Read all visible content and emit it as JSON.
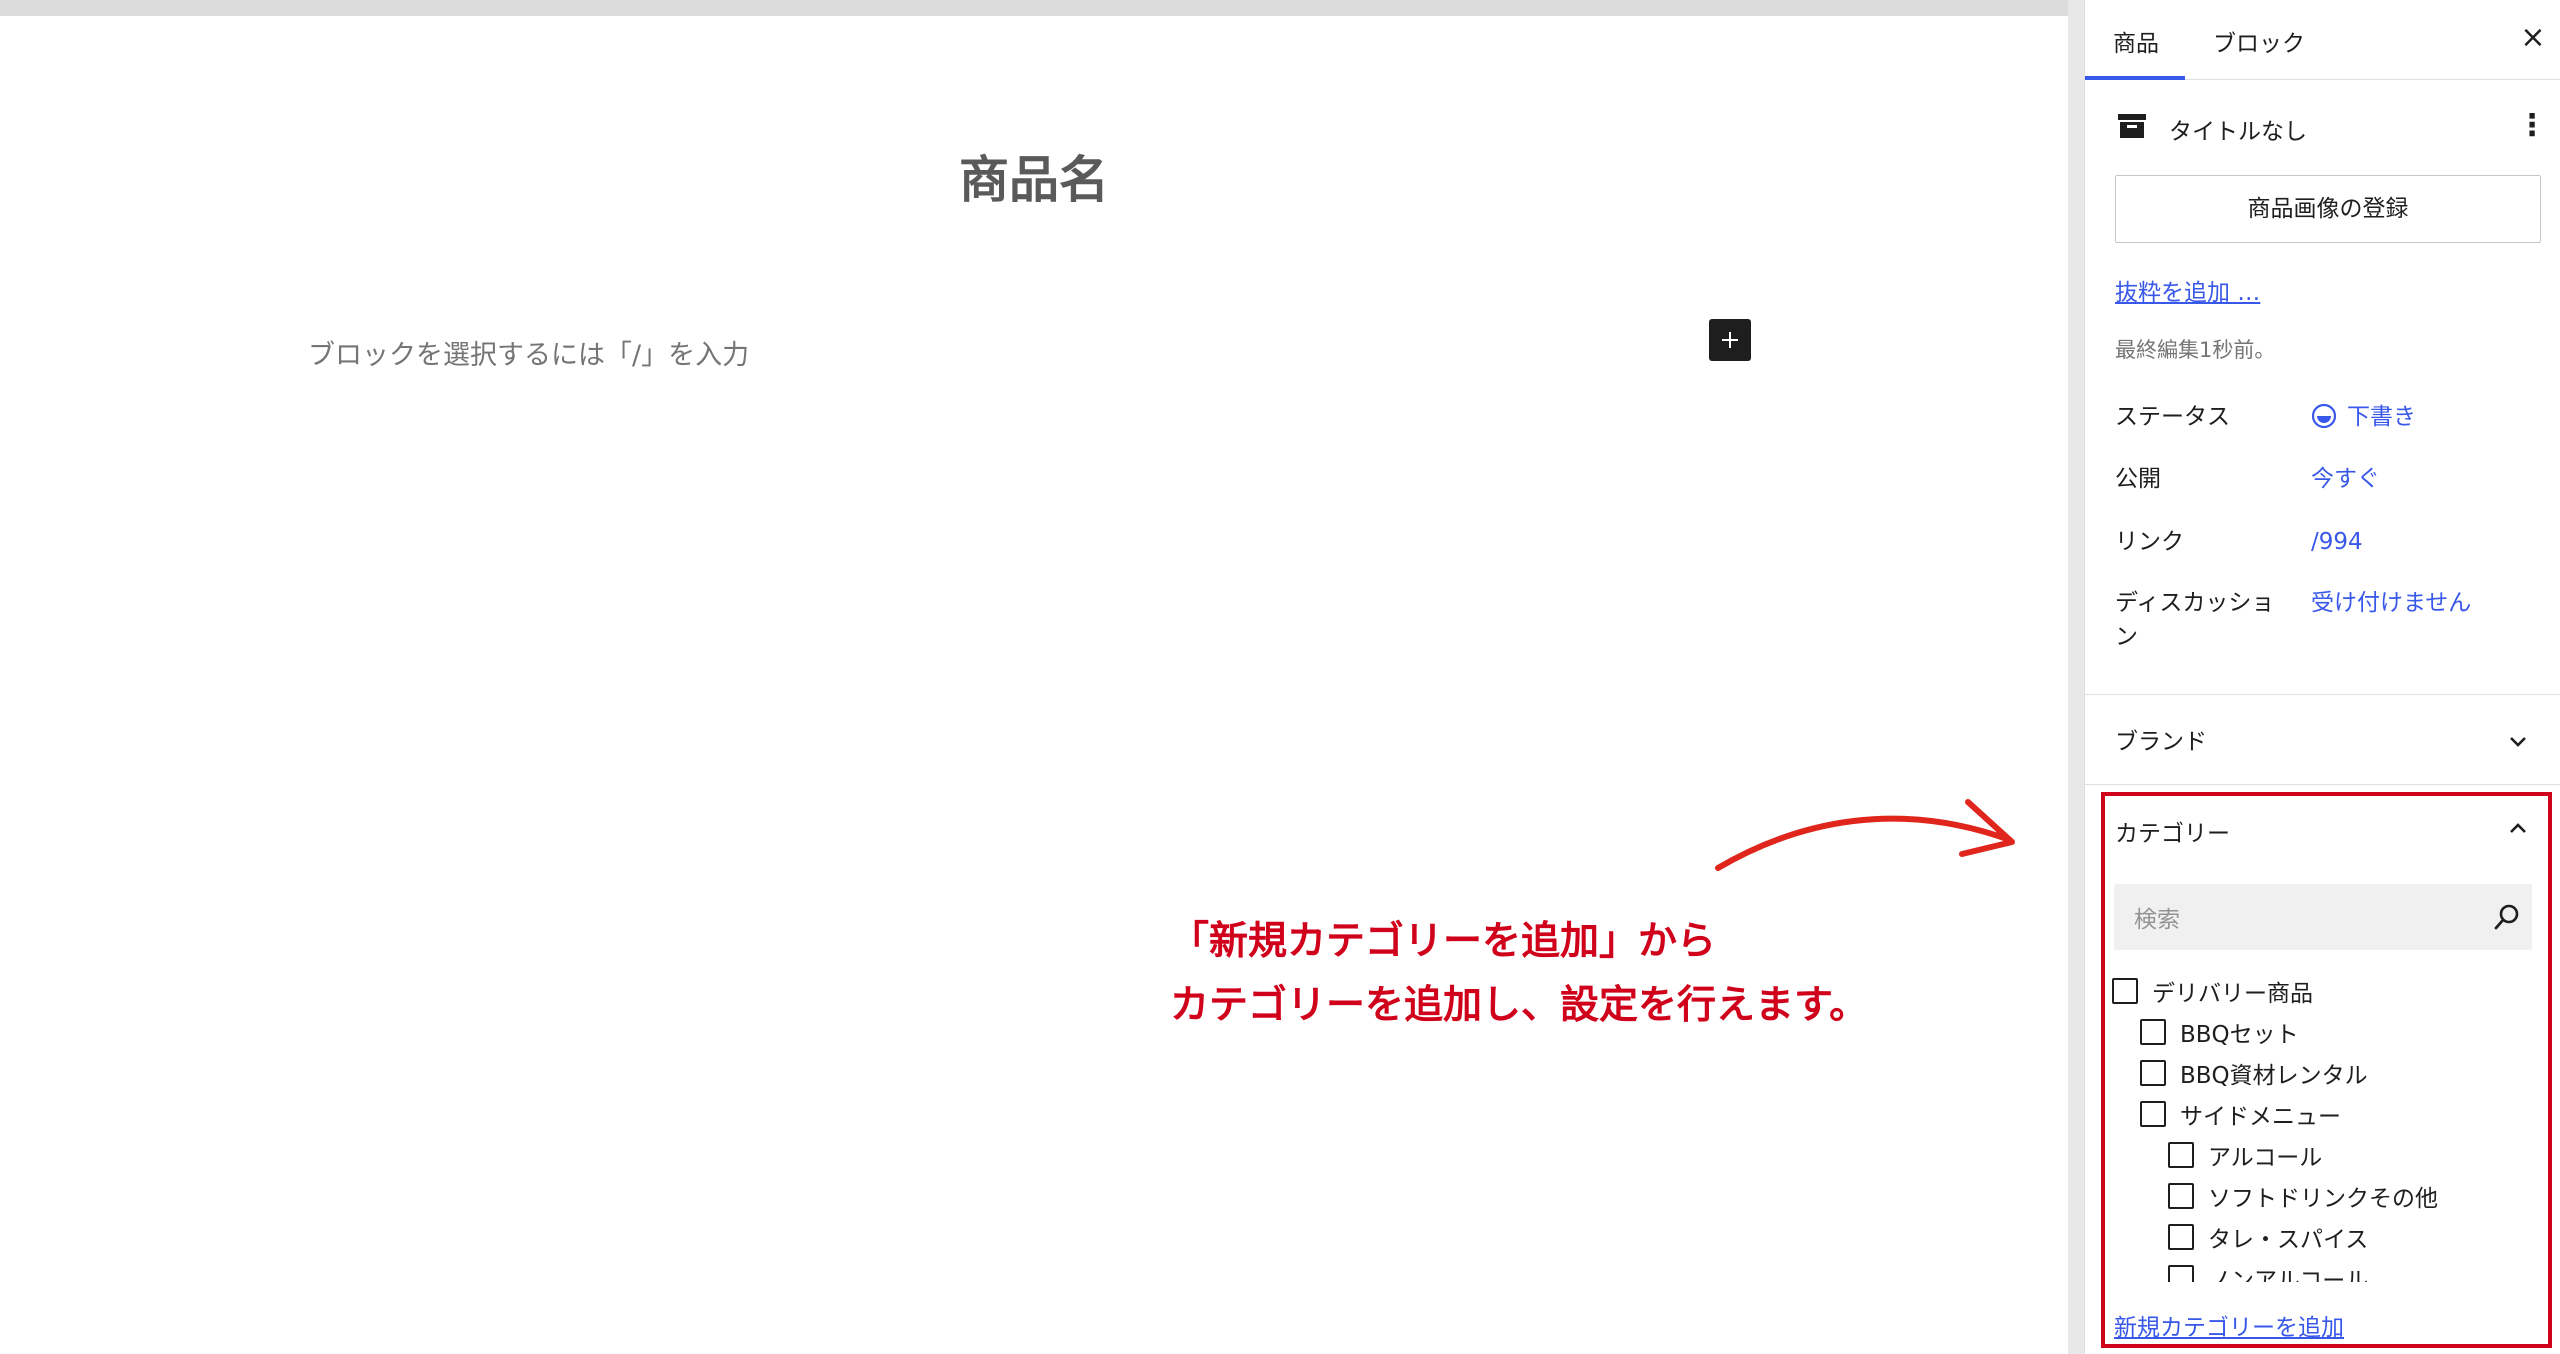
{
  "editor": {
    "post_title": "商品名",
    "block_placeholder": "ブロックを選択するには「/」を入力"
  },
  "annotation": {
    "line1": "「新規カテゴリーを追加」から",
    "line2": "カテゴリーを追加し、設定を行えます。",
    "color": "#d0021b"
  },
  "sidebar": {
    "tabs": [
      {
        "label": "商品",
        "active": true
      },
      {
        "label": "ブロック",
        "active": false
      }
    ],
    "close_icon": "close-icon",
    "summary": {
      "title": "タイトルなし",
      "image_button": "商品画像の登録",
      "excerpt_link": "抜粋を追加 …",
      "last_edited": "最終編集1秒前。"
    },
    "meta": [
      {
        "label": "ステータス",
        "value": "下書き"
      },
      {
        "label": "公開",
        "value": "今すぐ"
      },
      {
        "label": "リンク",
        "value": "/994"
      },
      {
        "label": "ディスカッション",
        "value": "受け付けません"
      }
    ],
    "brand_panel": {
      "title": "ブランド",
      "expanded": false
    },
    "category_panel": {
      "title": "カテゴリー",
      "expanded": true,
      "search_placeholder": "検索",
      "items": [
        {
          "label": "デリバリー商品",
          "level": 0,
          "checked": false
        },
        {
          "label": "BBQセット",
          "level": 1,
          "checked": false
        },
        {
          "label": "BBQ資材レンタル",
          "level": 1,
          "checked": false
        },
        {
          "label": "サイドメニュー",
          "level": 1,
          "checked": false
        },
        {
          "label": "アルコール",
          "level": 2,
          "checked": false
        },
        {
          "label": "ソフトドリンクその他",
          "level": 2,
          "checked": false
        },
        {
          "label": "タレ・スパイス",
          "level": 2,
          "checked": false
        },
        {
          "label": "ノンアルコール",
          "level": 2,
          "checked": false
        }
      ],
      "add_new_link": "新規カテゴリーを追加"
    },
    "accent_color": "#3858e9"
  }
}
